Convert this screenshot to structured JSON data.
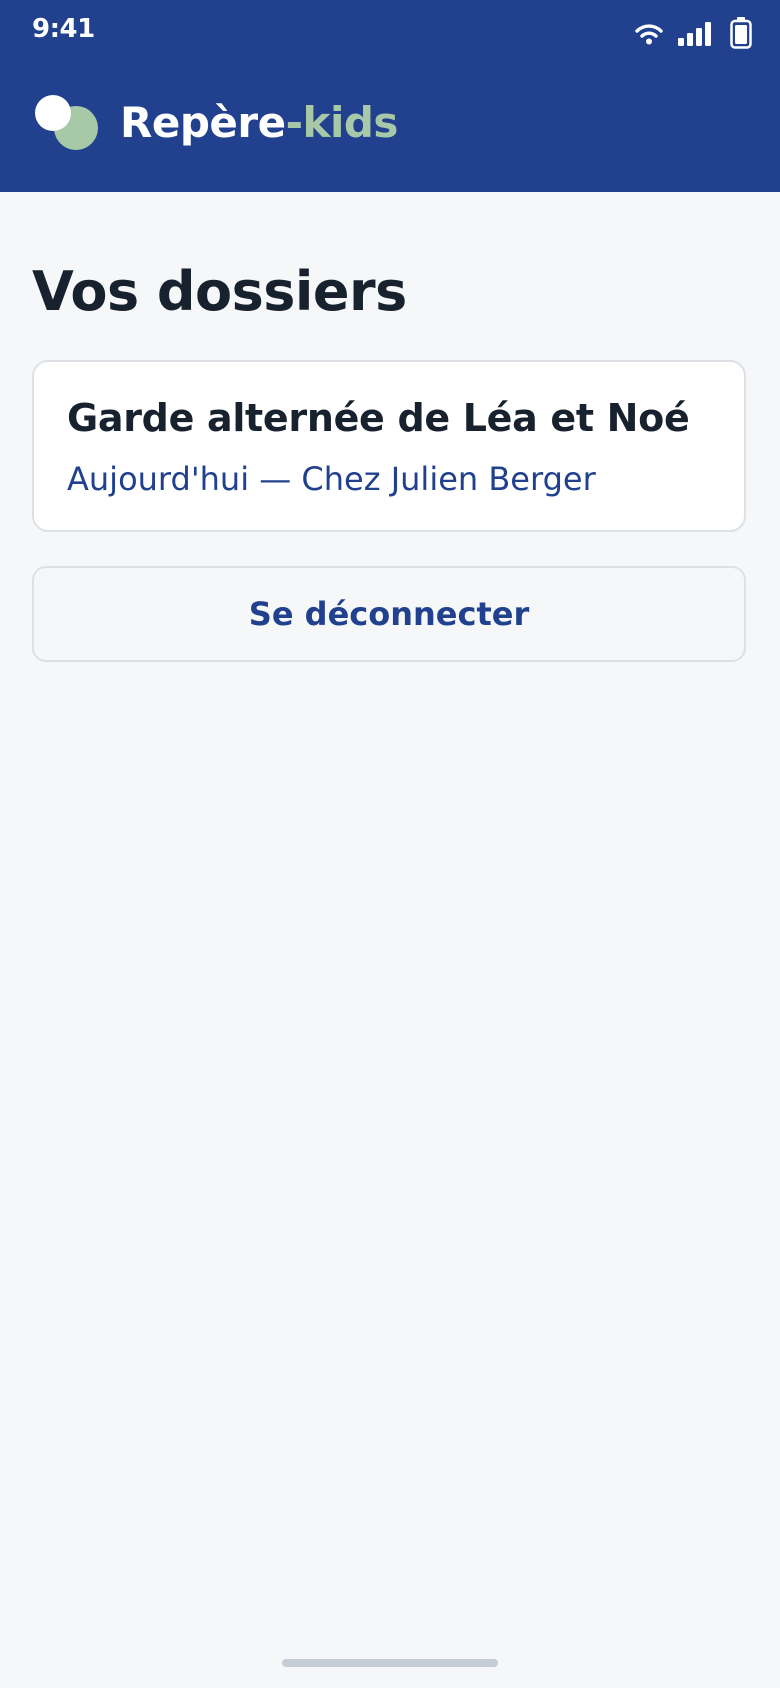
{
  "status_bar": {
    "time": "9:41",
    "icons": [
      "wifi-icon",
      "signal-icon",
      "battery-icon"
    ]
  },
  "header": {
    "app_name_primary": "Repère",
    "app_name_accent": "-kids",
    "logo": "app-logo"
  },
  "main": {
    "title": "Vos dossiers",
    "folders": [
      {
        "title": "Garde alternée de Léa et Noé",
        "subtitle": "Aujourd'hui — Chez Julien Berger"
      }
    ],
    "logout_label": "Se déconnecter"
  },
  "colors": {
    "primary": "#21418f",
    "accent": "#a7c9a8",
    "background": "#f5f7f9",
    "text_dark": "#18212e",
    "card_border": "#dde1e6"
  }
}
